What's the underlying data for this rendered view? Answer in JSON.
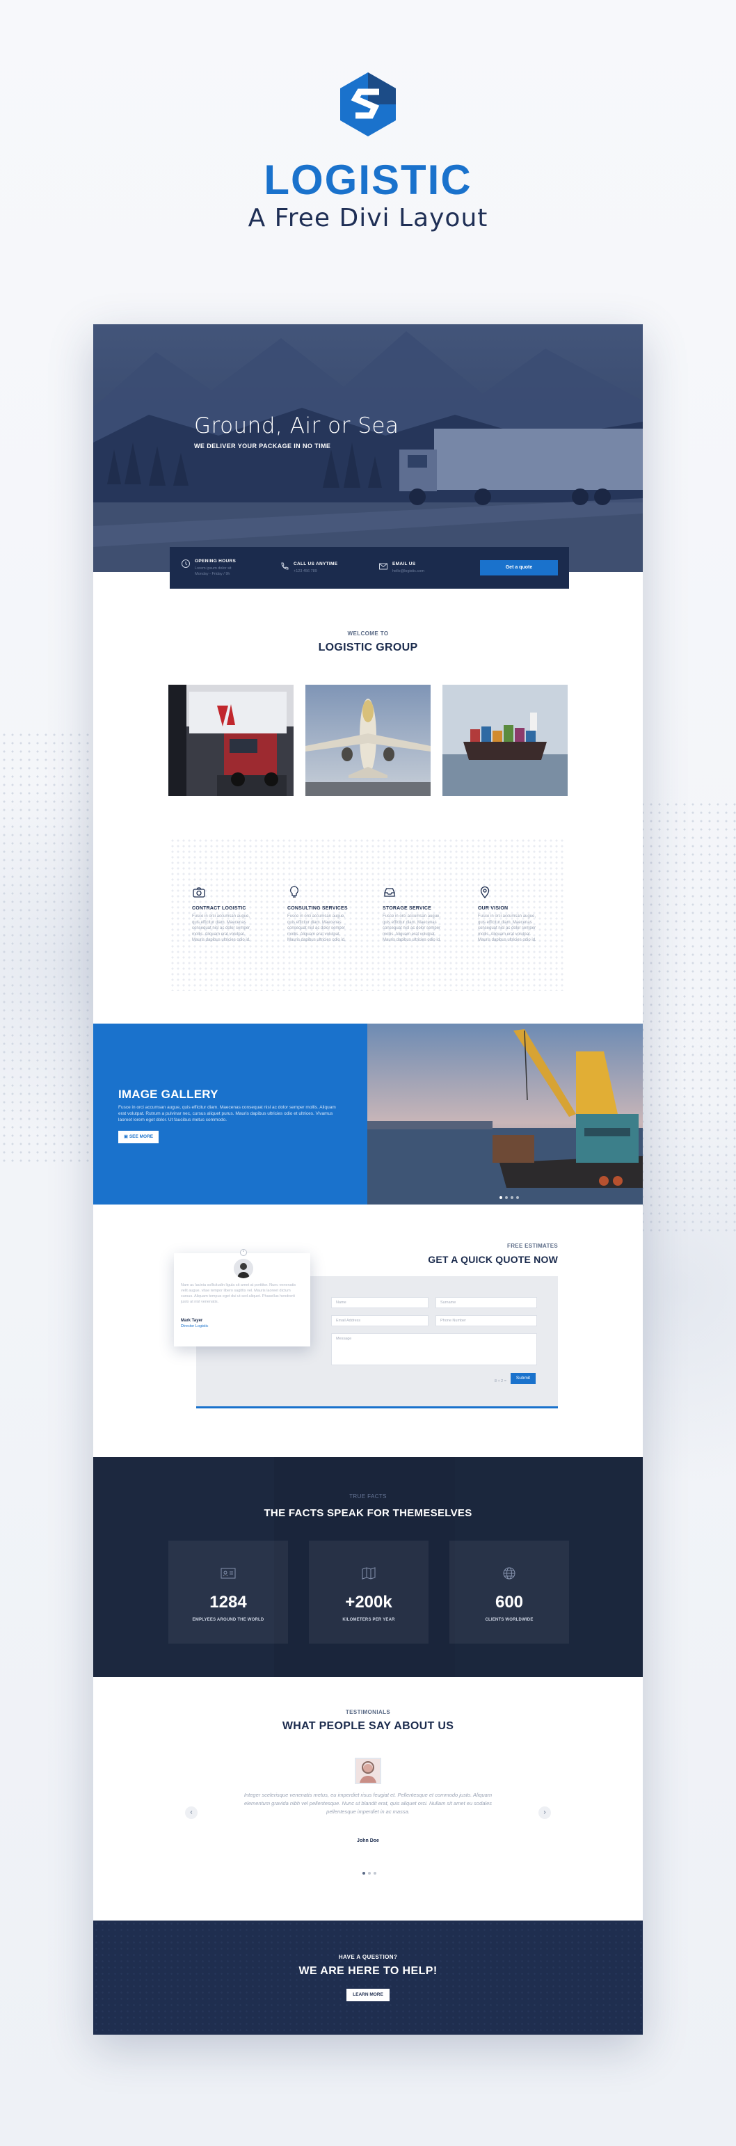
{
  "brand": {
    "name": "LOGISTIC",
    "subtitle": "A Free Divi Layout"
  },
  "colors": {
    "accent": "#1a72cc",
    "navy": "#1b2b4d",
    "dark": "#1a253b",
    "background": "#f1f3f8"
  },
  "hero": {
    "title": "Ground, Air or Sea",
    "subtitle": "WE DELIVER YOUR PACKAGE IN NO TIME",
    "info": [
      {
        "icon": "clock-icon",
        "title": "OPENING HOURS",
        "line1": "Lorem ipsum dolor sit",
        "line2": "Monday - Friday / 9h"
      },
      {
        "icon": "phone-icon",
        "title": "CALL US ANYTIME",
        "line1": "+123 456 789",
        "line2": ""
      },
      {
        "icon": "mail-icon",
        "title": "EMAIL US",
        "line1": "hello@logistic.com",
        "line2": ""
      }
    ],
    "quote_button": "Get a quote"
  },
  "welcome": {
    "kicker": "WELCOME TO",
    "title": "LOGISTIC GROUP"
  },
  "services": [
    {
      "icon": "camera-icon",
      "name": "CONTRACT LOGISTIC",
      "desc": "Fusce in orci accumsan augue, quis efficitur diam. Maecenas consequat nisl ac dolor semper mollis. Aliquam erat volutpat. Mauris dapibus ultricies odio id."
    },
    {
      "icon": "lightbulb-icon",
      "name": "CONSULTING SERVICES",
      "desc": "Fusce in orci accumsan augue, quis efficitur diam. Maecenas consequat nisl ac dolor semper mollis. Aliquam erat volutpat. Mauris dapibus ultricies odio id."
    },
    {
      "icon": "inbox-icon",
      "name": "STORAGE SERVICE",
      "desc": "Fusce in orci accumsan augue, quis efficitur diam. Maecenas consequat nisl ac dolor semper mollis. Aliquam erat volutpat. Mauris dapibus ultricies odio id."
    },
    {
      "icon": "map-pin-icon",
      "name": "OUR VISION",
      "desc": "Fusce in orci accumsan augue, quis efficitur diam. Maecenas consequat nisl ac dolor semper mollis. Aliquam erat volutpat. Mauris dapibus ultricies odio id."
    }
  ],
  "gallery": {
    "title": "IMAGE GALLERY",
    "text": "Fusce in orci accumsan augue, quis efficitur diam. Maecenas consequat nisl ac dolor semper mollis. Aliquam erat volutpat. Rutrum a pulvinar nec, cursus aliquet purus. Mauris dapibus ultricies odio et ultrices. Vivamus laoreet lorem eget dolor. Ut faucibus metus commodo.",
    "button": "SEE MORE"
  },
  "quote": {
    "kicker": "FREE ESTIMATES",
    "title": "GET A QUICK QUOTE NOW",
    "fields": {
      "name": "Name",
      "surname": "Surname",
      "email": "Email Address",
      "phone": "Phone Number",
      "message": "Message"
    },
    "captcha": "8 + 2 =",
    "submit": "Submit"
  },
  "testimonial_card": {
    "text": "Nam ac lacinia sollicitudin ligula sit amet at porttitor. Nunc venenatis velit augue, vitae tempor libero sagittis vel. Mauris laoreet dictum cursus. Aliquam tempus eget dui ut sed aliquet. Phasellus hendrerit justo at nisl venenatis.",
    "name": "Mark Tayer",
    "role": "Director Logistic"
  },
  "facts": {
    "kicker": "TRUE FACTS",
    "title": "THE FACTS SPEAK FOR THEMESELVES",
    "items": [
      {
        "icon": "id-card-icon",
        "value": "1284",
        "label": "EMPLYEES AROUND THE WORLD"
      },
      {
        "icon": "map-icon",
        "value": "+200k",
        "label": "KILOMETERS PER YEAR"
      },
      {
        "icon": "globe-icon",
        "value": "600",
        "label": "CLIENTS WORLDWIDE"
      }
    ]
  },
  "testimonials": {
    "kicker": "TESTIMONIALS",
    "title": "WHAT PEOPLE SAY ABOUT US",
    "text": "Integer scelerisque venenatis metus, eu imperdiet risus feugiat et. Pellentesque et commodo justo. Aliquam elementum gravida nibh vel pellentesque. Nunc ut blandit erat, quis aliquet orci. Nullam sit amet eu sodales pellentesque imperdiet in ac massa.",
    "name": "John Doe",
    "prev": "‹",
    "next": "›"
  },
  "cta": {
    "kicker": "HAVE A QUESTION?",
    "title": "WE ARE HERE TO HELP!",
    "button": "LEARN MORE"
  }
}
